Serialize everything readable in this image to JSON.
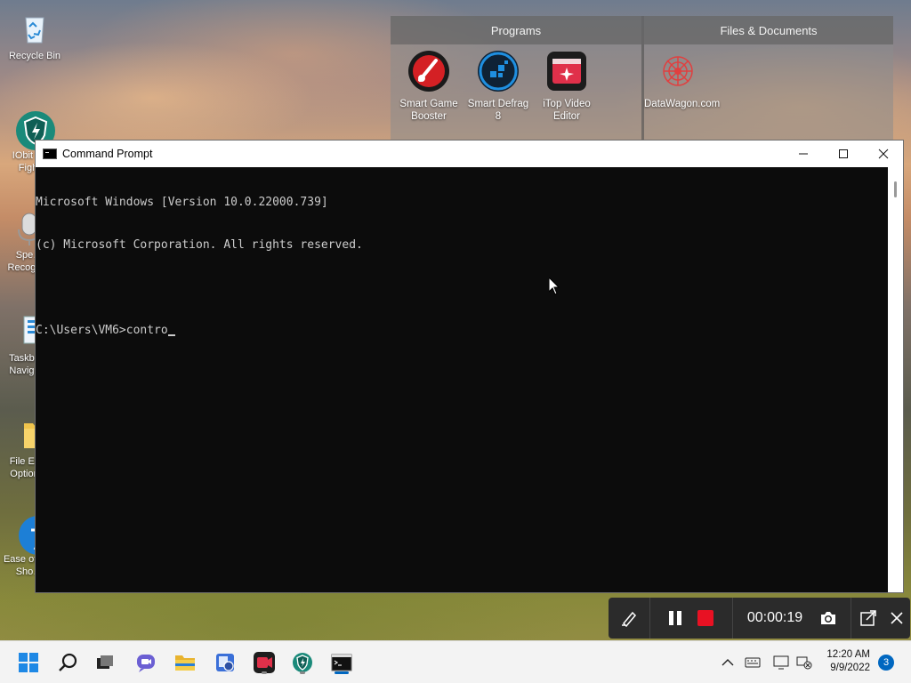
{
  "desktop": {
    "icons": [
      {
        "label": "Recycle Bin",
        "icon": "recycle-bin-icon"
      },
      {
        "label": "IObit M… Figh…",
        "icon": "iobit-malware-fighter-icon"
      },
      {
        "label": "Spe… Recogn…",
        "icon": "speech-recognition-icon"
      },
      {
        "label": "Taskba… Naviga…",
        "icon": "taskbar-navigation-icon"
      },
      {
        "label": "File Ex… Option…",
        "icon": "folder-icon"
      },
      {
        "label": "Ease of … - Sho…",
        "icon": "ease-of-access-icon"
      }
    ]
  },
  "panel": {
    "programs_header": "Programs",
    "files_header": "Files & Documents",
    "programs": [
      {
        "label": "Smart Game Booster",
        "icon": "smart-game-booster-icon",
        "color": "#e0262a"
      },
      {
        "label": "Smart Defrag 8",
        "icon": "smart-defrag-icon",
        "color": "#1f8fe0"
      },
      {
        "label": "iTop Video Editor",
        "icon": "itop-video-editor-icon",
        "color": "#e0304a"
      }
    ],
    "files": [
      {
        "label": "DataWagon.com",
        "icon": "datawagon-icon"
      }
    ]
  },
  "cmd": {
    "title": "Command Prompt",
    "lines": [
      "Microsoft Windows [Version 10.0.22000.739]",
      "(c) Microsoft Corporation. All rights reserved.",
      "",
      "C:\\Users\\VM6>contro"
    ]
  },
  "recorder": {
    "elapsed": "00:00:19"
  },
  "taskbar": {
    "apps": [
      "start-icon",
      "search-icon",
      "task-view-icon",
      "chat-icon",
      "file-explorer-icon",
      "app-icon",
      "itop-screen-recorder-icon",
      "iobit-malware-fighter-icon",
      "command-prompt-icon"
    ],
    "clock_time": "12:20 AM",
    "clock_date": "9/9/2022",
    "notification_count": "3"
  },
  "colors": {
    "accent": "#0067c0",
    "cmd_background": "#0c0c0c",
    "cmd_text": "#cccccc",
    "record_red": "#e81123"
  }
}
